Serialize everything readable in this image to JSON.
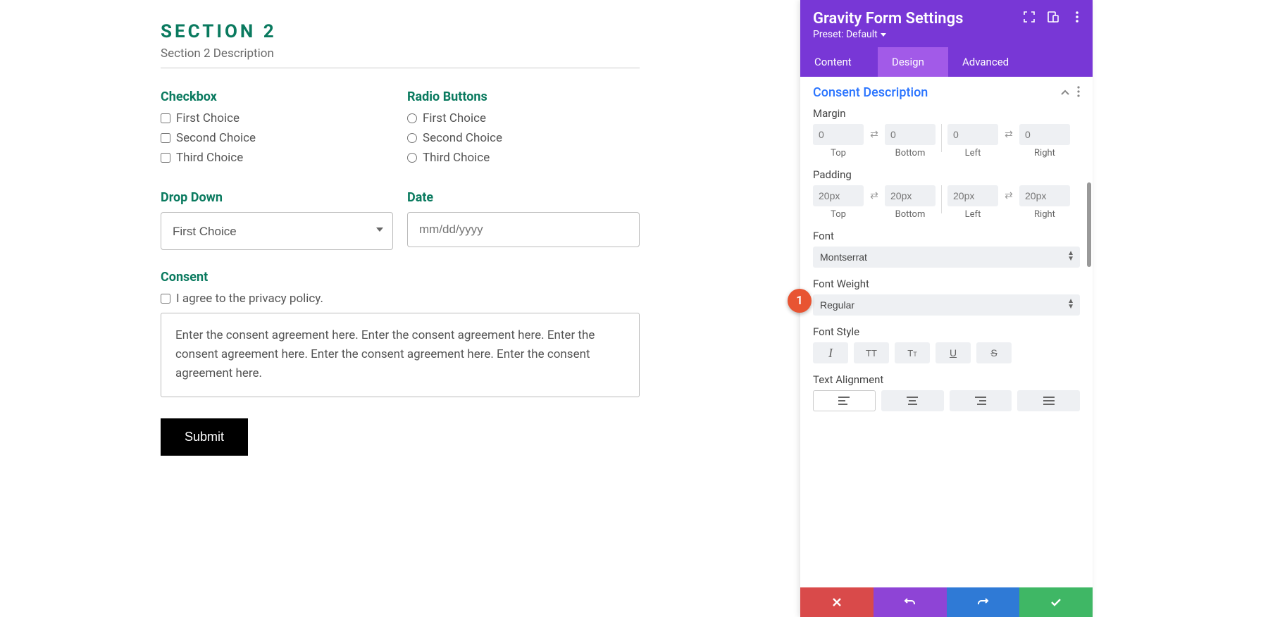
{
  "main": {
    "section_title": "SECTION 2",
    "section_desc": "Section 2 Description",
    "checkbox": {
      "label": "Checkbox",
      "choices": [
        "First Choice",
        "Second Choice",
        "Third Choice"
      ]
    },
    "radio": {
      "label": "Radio Buttons",
      "choices": [
        "First Choice",
        "Second Choice",
        "Third Choice"
      ]
    },
    "dropdown": {
      "label": "Drop Down",
      "value": "First Choice"
    },
    "date": {
      "label": "Date",
      "placeholder": "mm/dd/yyyy"
    },
    "consent": {
      "label": "Consent",
      "agree_text": "I agree to the privacy policy.",
      "body": "Enter the consent agreement here. Enter the consent agreement here. Enter the consent agreement here. Enter the consent agreement here. Enter the consent agreement here."
    },
    "submit_label": "Submit",
    "badge": "1"
  },
  "panel": {
    "title": "Gravity Form Settings",
    "preset": "Preset: Default",
    "tabs": {
      "content": "Content",
      "design": "Design",
      "advanced": "Advanced"
    },
    "section_header": "Consent Description",
    "margin": {
      "label": "Margin",
      "top": {
        "placeholder": "0",
        "label": "Top"
      },
      "bottom": {
        "placeholder": "0",
        "label": "Bottom"
      },
      "left": {
        "placeholder": "0",
        "label": "Left"
      },
      "right": {
        "placeholder": "0",
        "label": "Right"
      }
    },
    "padding": {
      "label": "Padding",
      "top": {
        "placeholder": "20px",
        "label": "Top"
      },
      "bottom": {
        "placeholder": "20px",
        "label": "Bottom"
      },
      "left": {
        "placeholder": "20px",
        "label": "Left"
      },
      "right": {
        "placeholder": "20px",
        "label": "Right"
      }
    },
    "font": {
      "label": "Font",
      "value": "Montserrat"
    },
    "font_weight": {
      "label": "Font Weight",
      "value": "Regular"
    },
    "font_style": {
      "label": "Font Style"
    },
    "text_alignment": {
      "label": "Text Alignment"
    }
  }
}
